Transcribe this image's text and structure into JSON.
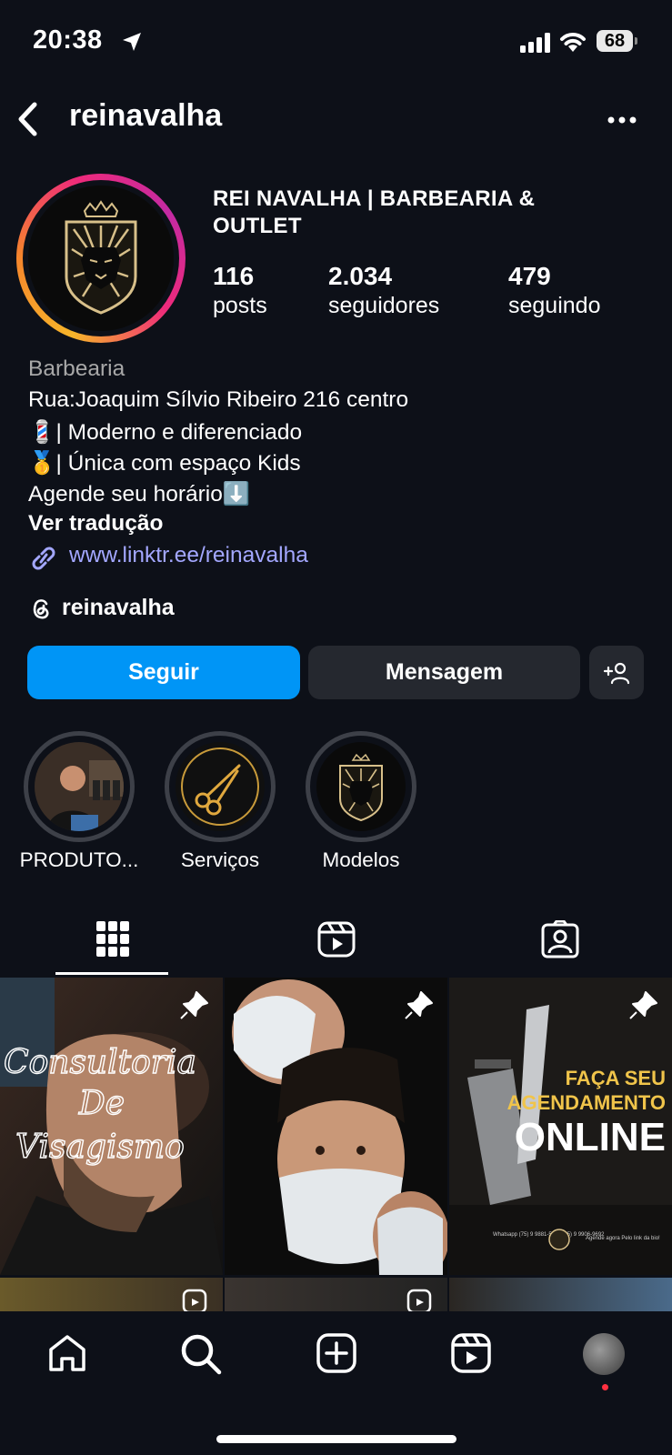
{
  "status_bar": {
    "time": "20:38",
    "battery": "68"
  },
  "header": {
    "username": "reinavalha"
  },
  "profile": {
    "display_name": "REI NAVALHA | BARBEARIA & OUTLET",
    "stats": [
      {
        "value": "116",
        "label": "posts"
      },
      {
        "value": "2.034",
        "label": "seguidores"
      },
      {
        "value": "479",
        "label": "seguindo"
      }
    ],
    "category": "Barbearia",
    "bio": [
      "Rua:Joaquim Sílvio Ribeiro 216 centro",
      "💈| Moderno e diferenciado",
      "🥇| Única com espaço Kids",
      "Agende seu horário⬇️"
    ],
    "see_translation": "Ver tradução",
    "link": "www.linktr.ee/reinavalha",
    "threads": "reinavalha"
  },
  "actions": {
    "follow": "Seguir",
    "message": "Mensagem"
  },
  "highlights": [
    {
      "label": "PRODUTO..."
    },
    {
      "label": "Serviços"
    },
    {
      "label": "Modelos"
    }
  ],
  "posts": [
    {
      "overlay_text": [
        "Consultoria",
        "De",
        "Visagismo"
      ]
    },
    {
      "overlay_text": []
    },
    {
      "overlay_text": [
        "FAÇA SEU",
        "AGENDAMENTO",
        "ONLINE"
      ],
      "small_left": "Whatsapp (75) 9 9881-5731 (75) 9 9906-9692",
      "small_right": "Agende agora Pelo link da bio!"
    }
  ],
  "colors": {
    "accent": "#0095f6",
    "background": "#0d1018",
    "link": "#a3a7ff"
  }
}
